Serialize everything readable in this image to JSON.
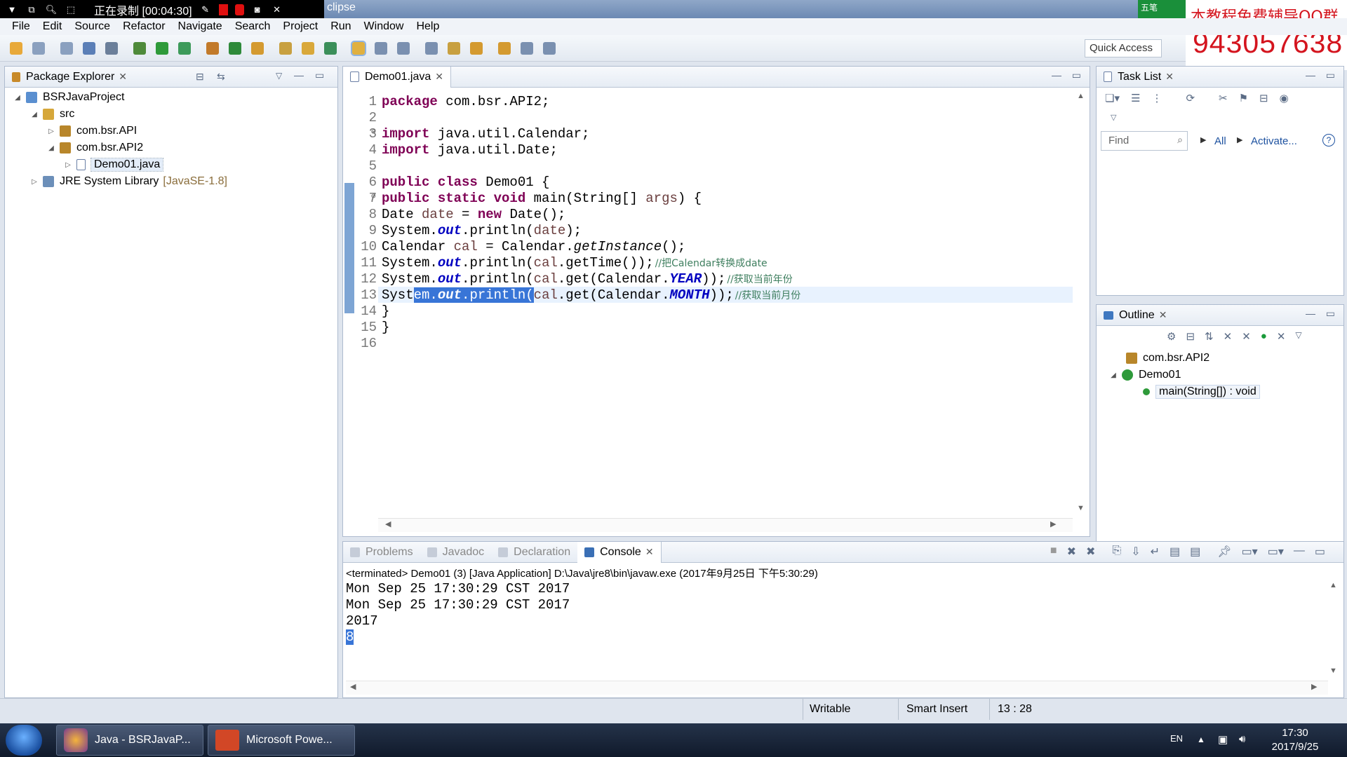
{
  "recording": {
    "label": "正在录制 [00:04:30]"
  },
  "window": {
    "title_fragment": "clipse"
  },
  "overlay": {
    "qq_text": "本教程免费辅导QQ群",
    "qq_number": "943057638",
    "corner_text": "五笔"
  },
  "menu": [
    "File",
    "Edit",
    "Source",
    "Refactor",
    "Navigate",
    "Search",
    "Project",
    "Run",
    "Window",
    "Help"
  ],
  "quick_access": "Quick Access",
  "package_explorer": {
    "title": "Package Explorer",
    "tree": [
      {
        "label": "BSRJavaProject",
        "depth": 0,
        "expanded": true,
        "icon": "project-icon"
      },
      {
        "label": "src",
        "depth": 1,
        "expanded": true,
        "icon": "source-folder-icon"
      },
      {
        "label": "com.bsr.API",
        "depth": 2,
        "expanded": false,
        "icon": "package-icon"
      },
      {
        "label": "com.bsr.API2",
        "depth": 2,
        "expanded": true,
        "icon": "package-icon"
      },
      {
        "label": "Demo01.java",
        "depth": 3,
        "expanded": false,
        "icon": "java-file-icon",
        "selected": true
      },
      {
        "label": "JRE System Library",
        "suffix": "[JavaSE-1.8]",
        "depth": 1,
        "expanded": false,
        "icon": "library-icon"
      }
    ]
  },
  "editor": {
    "tab": "Demo01.java",
    "lines": [
      {
        "n": "1",
        "html_key": "l1"
      },
      {
        "n": "2",
        "html_key": "l2"
      },
      {
        "n": "3",
        "html_key": "l3"
      },
      {
        "n": "4",
        "html_key": "l4"
      },
      {
        "n": "5",
        "html_key": "l5"
      },
      {
        "n": "6",
        "html_key": "l6"
      },
      {
        "n": "7",
        "html_key": "l7"
      },
      {
        "n": "8",
        "html_key": "l8"
      },
      {
        "n": "9",
        "html_key": "l9"
      },
      {
        "n": "10",
        "html_key": "l10"
      },
      {
        "n": "11",
        "html_key": "l11"
      },
      {
        "n": "12",
        "html_key": "l12"
      },
      {
        "n": "13",
        "html_key": "l13"
      },
      {
        "n": "14",
        "html_key": "l14"
      },
      {
        "n": "15",
        "html_key": "l15"
      },
      {
        "n": "16",
        "html_key": "l16"
      }
    ],
    "code": {
      "pkg_kw": "package",
      "pkg_name": " com.bsr.API2;",
      "imp_kw": "import",
      "imp1": " java.util.Calendar;",
      "imp2": " java.util.Date;",
      "cls_kw": "public class",
      "cls_name": " Demo01 {",
      "main_kw": "public static void",
      "main_sig": " main(String[] ",
      "main_args": "args",
      "main_end": ") {",
      "date_type": "Date ",
      "date_var": "date",
      "date_eq": " = ",
      "new_kw": "new",
      "date_ctor": " Date();",
      "sys": "System.",
      "out": "out",
      "println_date": ".println(",
      "date_ref": "date",
      "close": ");",
      "cal_type": "Calendar ",
      "cal_var": "cal",
      "cal_eq": " = Calendar.",
      "getinst": "getInstance",
      "cal_end": "();",
      "l11_a": ".println(",
      "l11_cal": "cal",
      "l11_b": ".getTime());",
      "l11_cm": "//把Calendar转换成date",
      "l12_a": ".println(",
      "l12_cal": "cal",
      "l12_b": ".get(Calendar.",
      "year": "YEAR",
      "l12_c": "));",
      "l12_cm": "//获取当前年份",
      "l13_pre": "Syst",
      "l13_sel1": "em.",
      "l13_sel_out": "out",
      "l13_sel2": ".println(",
      "l13_cal": "cal",
      "l13_b": ".get(Calendar.",
      "month": "MONTH",
      "l13_c": "));",
      "l13_cm": "//获取当前月份",
      "brace_close": "}"
    }
  },
  "task_list": {
    "title": "Task List",
    "find_placeholder": "Find",
    "all": "All",
    "activate": "Activate..."
  },
  "outline": {
    "title": "Outline",
    "items": [
      {
        "label": "com.bsr.API2",
        "icon": "package-icon"
      },
      {
        "label": "Demo01",
        "icon": "class-icon"
      },
      {
        "label": "main(String[]) : void",
        "icon": "method-icon"
      }
    ]
  },
  "bottom_tabs": [
    "Problems",
    "Javadoc",
    "Declaration",
    "Console"
  ],
  "console": {
    "header": "<terminated> Demo01 (3) [Java Application] D:\\Java\\jre8\\bin\\javaw.exe (2017年9月25日 下午5:30:29)",
    "lines": [
      "Mon Sep 25 17:30:29 CST 2017",
      "Mon Sep 25 17:30:29 CST 2017",
      "2017",
      "8"
    ]
  },
  "status": {
    "writable": "Writable",
    "insert_mode": "Smart Insert",
    "position": "13 : 28"
  },
  "taskbar": {
    "buttons": [
      "Java - BSRJavaP...",
      "Microsoft Powe..."
    ],
    "lang": "EN",
    "time": "17:30",
    "date": "2017/9/25"
  },
  "colors": {
    "keyword": "#7f0055",
    "field": "#0000c0",
    "comment": "#3f7f5f",
    "selection": "#3875d7",
    "overlay_red": "#d4141e"
  }
}
